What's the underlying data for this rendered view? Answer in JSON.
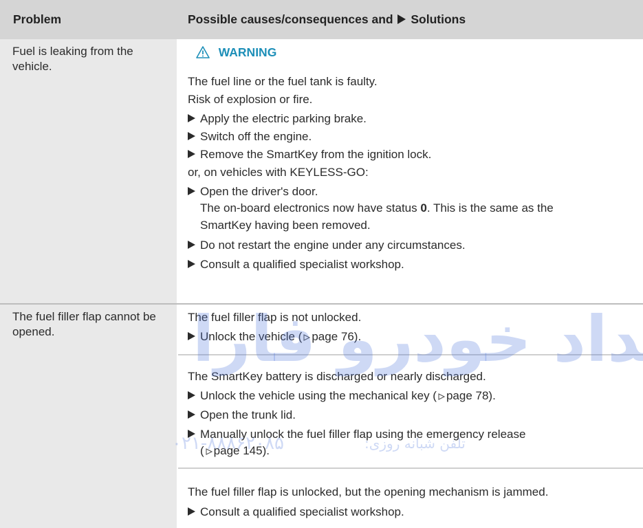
{
  "header": {
    "problem": "Problem",
    "solutions_pre": "Possible causes/consequences and",
    "solutions_post": "Solutions"
  },
  "rows": [
    {
      "problem": "Fuel is leaking from the vehicle.",
      "warning": "WARNING",
      "cause_1": "The fuel line or the fuel tank is faulty.",
      "cause_2": "Risk of explosion or fire.",
      "step_1": "Apply the electric parking brake.",
      "step_2": "Switch off the engine.",
      "step_3": "Remove the SmartKey from the ignition lock.",
      "or_text": "or, on vehicles with KEYLESS-GO:",
      "step_4": "Open the driver's door.",
      "step_4_note_a": "The on-board electronics now have status ",
      "step_4_note_bold": "0",
      "step_4_note_b": ". This is the same as the",
      "step_4_note_c": "SmartKey having been removed.",
      "step_5": "Do not restart the engine under any circumstances.",
      "step_6": "Consult a qualified specialist workshop."
    },
    {
      "problem": "The fuel filler flap cannot be opened.",
      "cause_a": "The fuel filler flap is not unlocked.",
      "step_a1_pre": "Unlock the vehicle (",
      "step_a1_page": "page 76",
      "step_a1_post": ").",
      "cause_b": "The SmartKey battery is discharged or nearly discharged.",
      "step_b1_pre": "Unlock the vehicle using the mechanical key (",
      "step_b1_page": "page 78",
      "step_b1_post": ").",
      "step_b2": "Open the trunk lid.",
      "step_b3": "Manually unlock the fuel filler flap using the emergency release",
      "step_b3_page": "page 145",
      "step_b3_post": ").",
      "cause_c": "The fuel filler flap is unlocked, but the opening mechanism is jammed.",
      "step_c1": "Consult a qualified specialist workshop."
    }
  ],
  "watermark": {
    "main": "امداد خودرو فارا",
    "phone": "۰۲۱-۸۸۸۶۲۰۸۵",
    "label": "تلفن شبانه روزی:"
  },
  "colors": {
    "header_bg": "#d5d5d5",
    "problem_bg": "#e9e9e9",
    "warning": "#1d8fb8",
    "watermark": "rgba(80,120,220,0.28)"
  }
}
